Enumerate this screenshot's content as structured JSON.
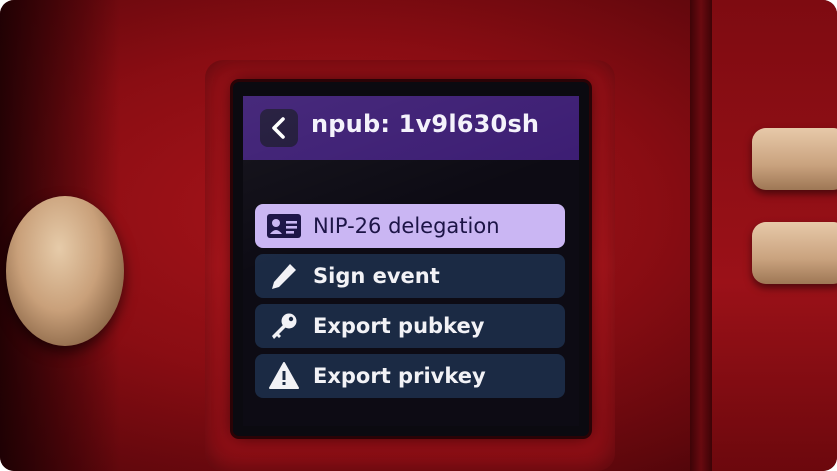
{
  "screen": {
    "header": {
      "back_icon": "chevron-left-icon",
      "title": "npub: 1v9l630sh"
    },
    "menu": {
      "items": [
        {
          "label": "NIP-26 delegation",
          "icon": "id-card-icon",
          "selected": true
        },
        {
          "label": "Sign event",
          "icon": "pencil-icon",
          "selected": false
        },
        {
          "label": "Export pubkey",
          "icon": "key-icon",
          "selected": false
        },
        {
          "label": "Export privkey",
          "icon": "warning-icon",
          "selected": false
        }
      ]
    }
  },
  "colors": {
    "device_case": "#9c1017",
    "header_bg": "#3d1e74",
    "selected_item_bg": "#cab6f3",
    "item_bg": "#1b2a44",
    "screen_bg": "#0d0b14"
  }
}
